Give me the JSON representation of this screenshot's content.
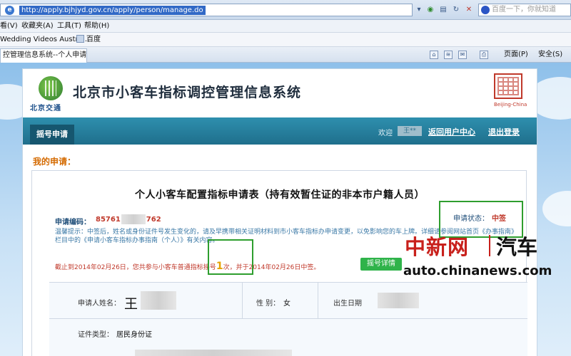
{
  "browser": {
    "address_url": "http://apply.bjhjyd.gov.cn/apply/person/manage.do",
    "search_placeholder": "百度一下，你就知道",
    "menu": [
      "看(V)",
      "收藏夹(A)",
      "工具(T)",
      "帮助(H)"
    ],
    "favorites": [
      "Wedding Videos Austra...",
      "百度"
    ],
    "tab_title": "控管理信息系统--个人申请",
    "tools": [
      "页面(P)",
      "安全(S)"
    ]
  },
  "site": {
    "logo_text": "北京交通",
    "title": "北京市小客车指标调控管理信息系统",
    "seal_caption": "Beijing-China"
  },
  "nav": {
    "tab_label": "摇号申请",
    "welcome": "欢迎",
    "username": "王**",
    "user_center": "返回用户中心",
    "logout": "退出登录"
  },
  "section_label": "我的申请：",
  "form": {
    "title": "个人小客车配置指标申请表（持有效暂住证的非本市户籍人员）",
    "app_no_label": "申请编码：",
    "app_no_prefix": "85761",
    "app_no_suffix": "762",
    "status_label": "申请状态：",
    "status_value": "中签",
    "tip": "温馨提示：中签后，姓名或身份证件号发生变化的，请及早携带相关证明材料到市小客车指标办申请变更，以免影响您的车上牌。详细请参阅网站首页《办事指南》栏目中的《申请小客车指标办事指南（个人）》有关内容。",
    "notice_before": "截止到2014年02月26日，您共参与小客车普通指标摇号",
    "notice_count": "1",
    "notice_after": "次，并于2014年02月26日中签。",
    "detail_button": "摇号详情"
  },
  "applicant": {
    "name_label": "申请人姓名：",
    "name_value": "王",
    "gender_label": "性 别：",
    "gender_value": "女",
    "birth_label": "出生日期",
    "id_type_label": "证件类型：",
    "id_type_value": "居民身份证"
  },
  "watermark": {
    "brand": "中新网",
    "sub": "汽车",
    "url": "auto.chinanews.com"
  }
}
